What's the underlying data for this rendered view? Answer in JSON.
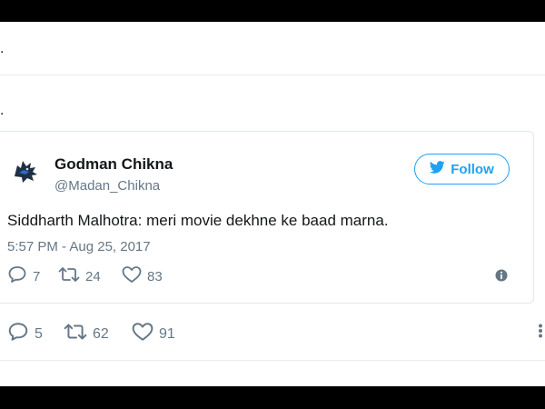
{
  "outer_tweet": {
    "text_top": ".",
    "text_second": "."
  },
  "quoted_tweet": {
    "author": {
      "display_name": "Godman Chikna",
      "handle": "@Madan_Chikna",
      "avatar_icon": "wolf-head-avatar-icon"
    },
    "follow_label": "Follow",
    "text": "Siddharth Malhotra: meri movie dekhne ke baad marna.",
    "timestamp": "5:57 PM - Aug 25, 2017",
    "actions": {
      "replies": "7",
      "retweets": "24",
      "likes": "83"
    },
    "info_icon": "info-icon"
  },
  "outer_actions": {
    "replies": "5",
    "retweets": "62",
    "likes": "91",
    "more_icon": "more-vertical-icon"
  },
  "colors": {
    "accent": "#1da1f2",
    "secondary_text": "#657786",
    "primary_text": "#14171a",
    "border": "#e1e8ed",
    "frame": "#000000"
  }
}
